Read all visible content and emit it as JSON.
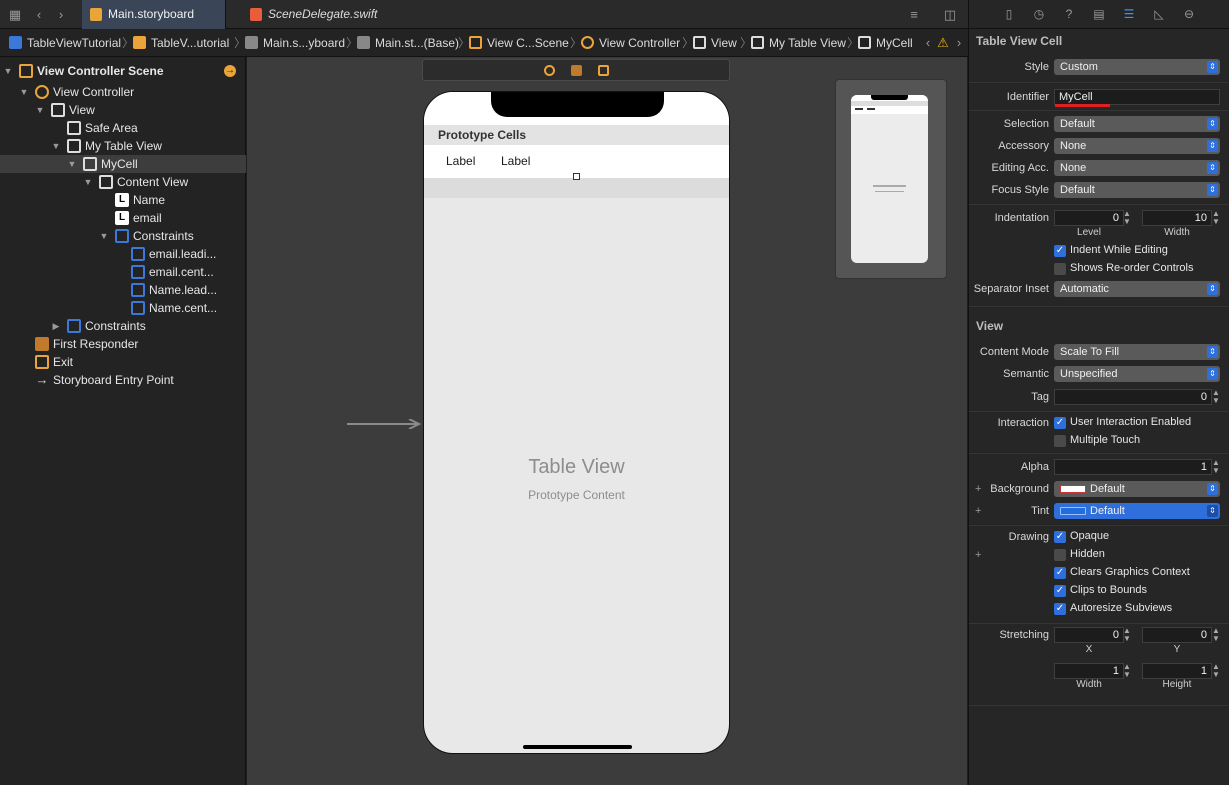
{
  "tabs": {
    "storyboard": "Main.storyboard",
    "swift": "SceneDelegate.swift"
  },
  "breadcrumb": [
    "TableViewTutorial",
    "TableV...utorial",
    "Main.s...yboard",
    "Main.st...(Base)",
    "View C...Scene",
    "View Controller",
    "View",
    "My Table View",
    "MyCell"
  ],
  "outline": {
    "scene": "View Controller Scene",
    "view_controller": "View Controller",
    "view": "View",
    "safe_area": "Safe Area",
    "table_view": "My Table View",
    "cell": "MyCell",
    "content_view": "Content View",
    "label_name": "Name",
    "label_email": "email",
    "constraints_inner": "Constraints",
    "c1": "email.leadi...",
    "c2": "email.cent...",
    "c3": "Name.lead...",
    "c4": "Name.cent...",
    "constraints_outer": "Constraints",
    "first_responder": "First Responder",
    "exit": "Exit",
    "entry_point": "Storyboard Entry Point",
    "label_icon_glyph": "L"
  },
  "canvas": {
    "prototype_header": "Prototype Cells",
    "cell_label_1": "Label",
    "cell_label_2": "Label",
    "table_title": "Table View",
    "table_subtitle": "Prototype Content"
  },
  "inspector": {
    "cell_section": "Table View Cell",
    "style_label": "Style",
    "style_value": "Custom",
    "identifier_label": "Identifier",
    "identifier_value": "MyCell",
    "selection_label": "Selection",
    "selection_value": "Default",
    "accessory_label": "Accessory",
    "accessory_value": "None",
    "editing_acc_label": "Editing Acc.",
    "editing_acc_value": "None",
    "focus_style_label": "Focus Style",
    "focus_style_value": "Default",
    "indentation_label": "Indentation",
    "level_value": "0",
    "width_value": "10",
    "level_caption": "Level",
    "width_caption": "Width",
    "indent_while_editing": "Indent While Editing",
    "shows_reorder": "Shows Re-order Controls",
    "separator_label": "Separator Inset",
    "separator_value": "Automatic",
    "view_section": "View",
    "content_mode_label": "Content Mode",
    "content_mode_value": "Scale To Fill",
    "semantic_label": "Semantic",
    "semantic_value": "Unspecified",
    "tag_label": "Tag",
    "tag_value": "0",
    "interaction_label": "Interaction",
    "user_interaction": "User Interaction Enabled",
    "multiple_touch": "Multiple Touch",
    "alpha_label": "Alpha",
    "alpha_value": "1",
    "background_label": "Background",
    "background_value": "Default",
    "tint_label": "Tint",
    "tint_value": "Default",
    "drawing_label": "Drawing",
    "opaque": "Opaque",
    "hidden": "Hidden",
    "clears_context": "Clears Graphics Context",
    "clips_bounds": "Clips to Bounds",
    "autoresize": "Autoresize Subviews",
    "stretching_label": "Stretching",
    "stretch_x": "0",
    "stretch_y": "0",
    "x_caption": "X",
    "y_caption": "Y",
    "stretch_w": "1",
    "stretch_h": "1",
    "w_caption": "Width",
    "h_caption": "Height"
  },
  "colors": {
    "accent": "#2f6fdb",
    "highlight_underline": "#e0201f",
    "warning": "#f5b400",
    "storyboard_icon": "#e9a43a",
    "tint_swatch": "#1f6fe0"
  }
}
